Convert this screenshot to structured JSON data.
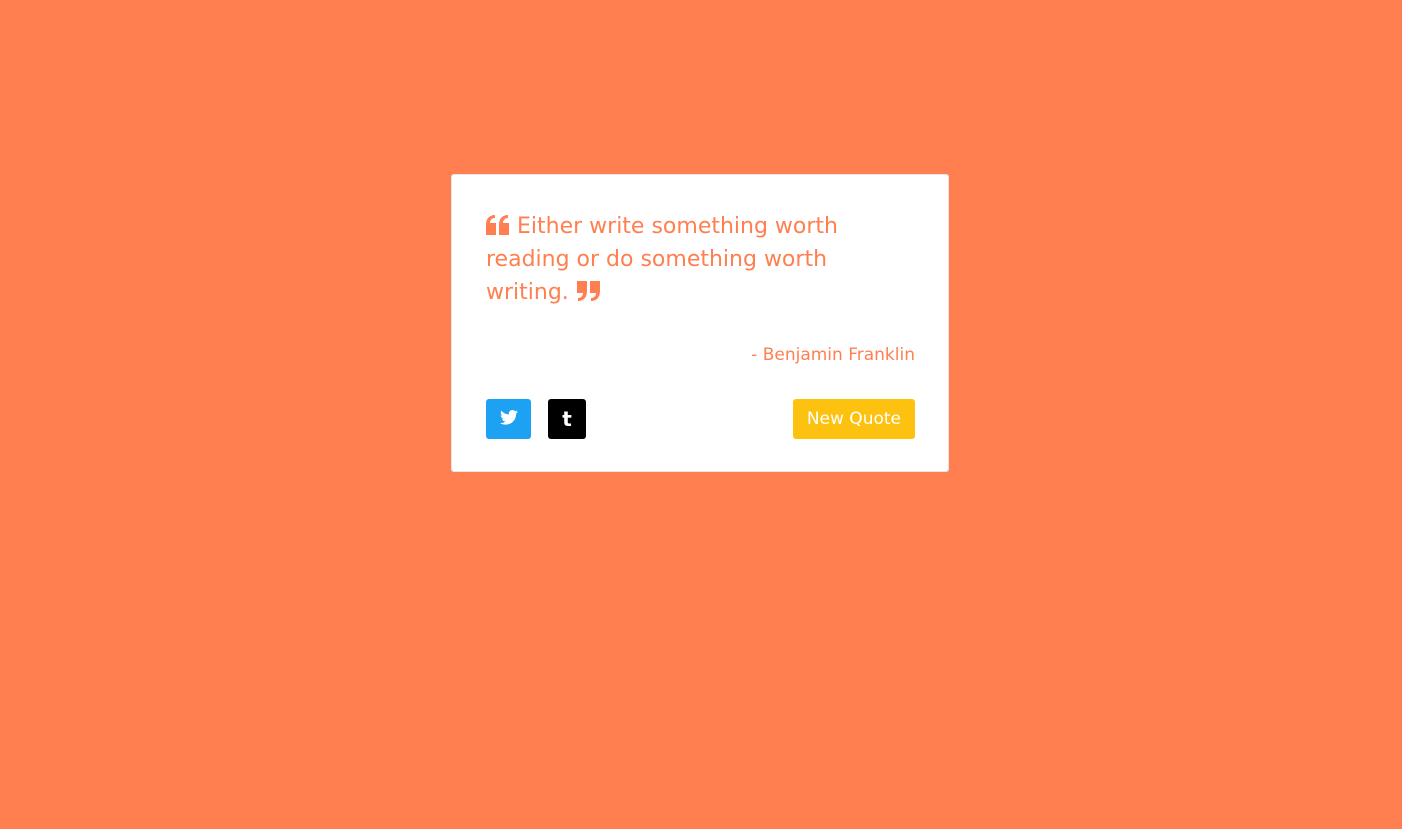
{
  "theme": {
    "background_color": "#ff7f50",
    "card_color": "#ffffff",
    "accent_color": "#ff7f50",
    "twitter_color": "#1da1f2",
    "tumblr_color": "#000000",
    "button_color": "#fcc20f"
  },
  "quote": {
    "text": "Either write something worth reading or do something worth writing.",
    "author": "- Benjamin Franklin",
    "open_icon": "quote-left-icon",
    "close_icon": "quote-right-icon"
  },
  "actions": {
    "twitter_icon": "twitter-icon",
    "tumblr_icon": "tumblr-icon",
    "tumblr_glyph": "t",
    "new_quote_label": "New Quote"
  }
}
